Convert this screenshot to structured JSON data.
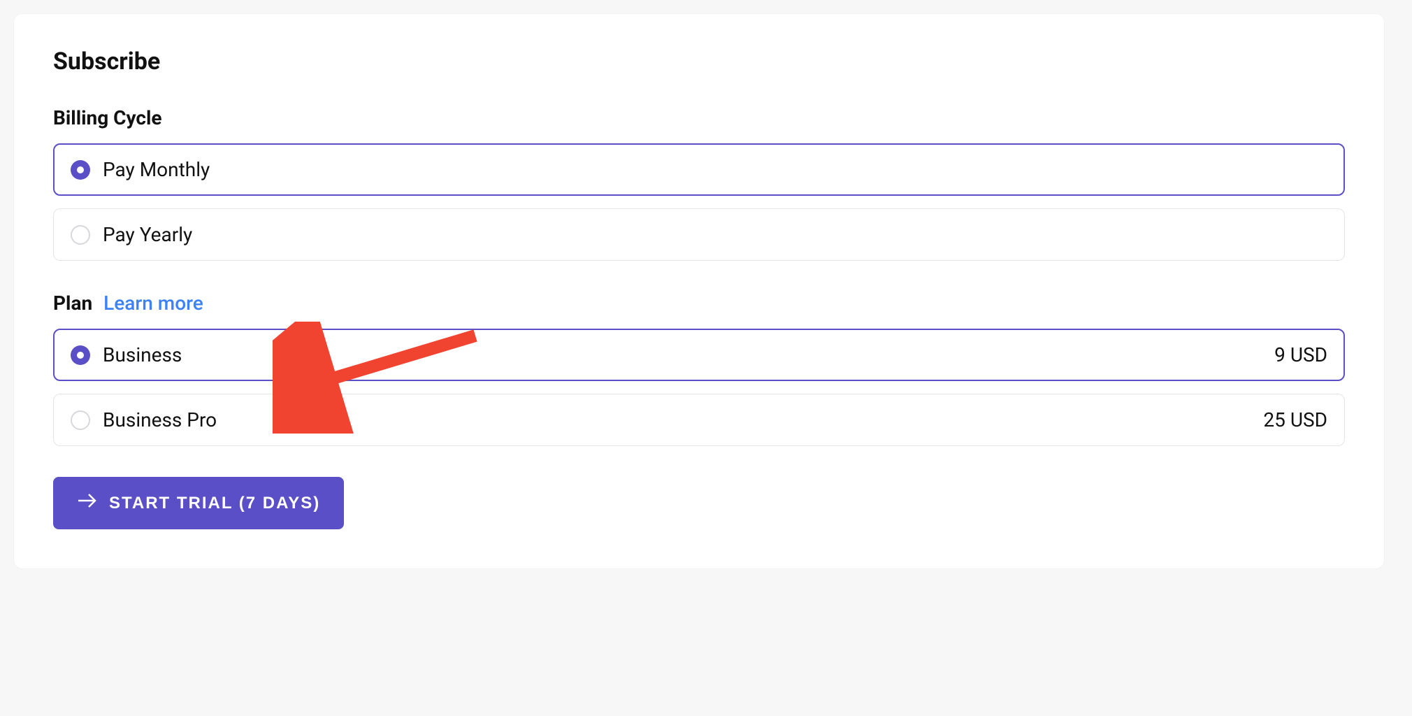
{
  "card": {
    "title": "Subscribe",
    "billing": {
      "label": "Billing Cycle",
      "options": [
        {
          "label": "Pay Monthly",
          "selected": true
        },
        {
          "label": "Pay Yearly",
          "selected": false
        }
      ]
    },
    "plan": {
      "label": "Plan",
      "learn_more": "Learn more",
      "options": [
        {
          "label": "Business",
          "price": "9 USD",
          "selected": true
        },
        {
          "label": "Business Pro",
          "price": "25 USD",
          "selected": false
        }
      ]
    },
    "cta": {
      "label": "START TRIAL (7 DAYS)"
    }
  },
  "colors": {
    "accent": "#5b4fc7",
    "link": "#3b82f6",
    "annotation": "#f04430"
  }
}
